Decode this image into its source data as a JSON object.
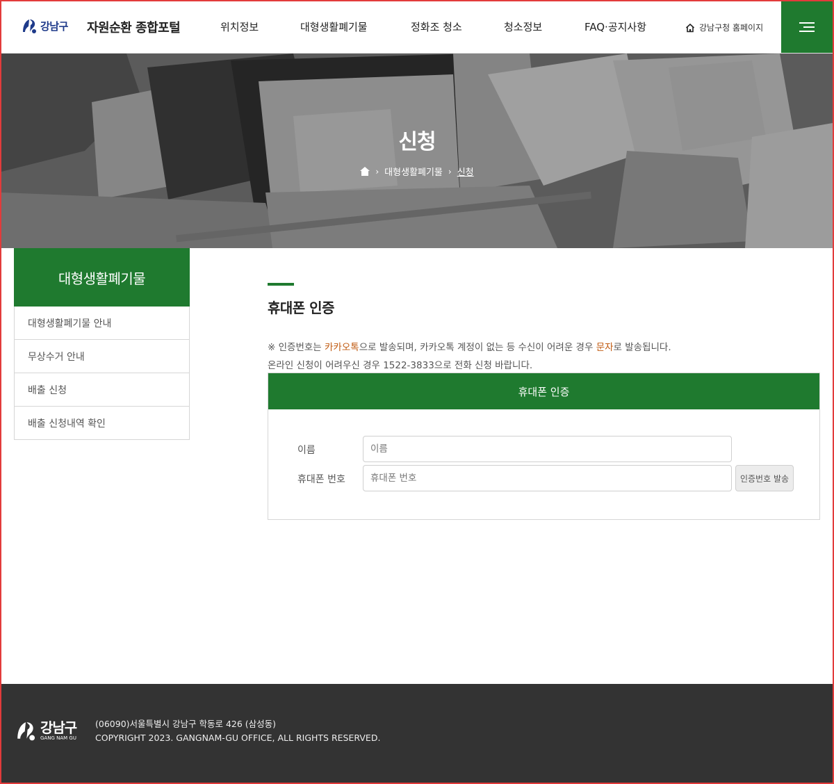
{
  "header": {
    "logo_text": "강남구",
    "site_title": "자원순환 종합포털",
    "nav": [
      "위치정보",
      "대형생활폐기물",
      "정화조 청소",
      "청소정보",
      "FAQ·공지사항"
    ],
    "home_link": "강남구청 홈페이지",
    "menu_icon": "hamburger-icon"
  },
  "hero": {
    "title": "신청",
    "breadcrumb": [
      "대형생활폐기물",
      "신청"
    ],
    "home_icon": "home-icon"
  },
  "sidebar": {
    "title": "대형생활폐기물",
    "items": [
      "대형생활폐기물 안내",
      "무상수거 안내",
      "배출 신청",
      "배출 신청내역 확인"
    ]
  },
  "content": {
    "section_title": "휴대폰 인증",
    "notice_line1": {
      "prefix": "※ 인증번호는 ",
      "hl1": "카카오톡",
      "middle": "으로 발송되며, 카카오톡 계정이 없는 등 수신이 어려운 경우 ",
      "hl2": "문자",
      "suffix": "로 발송됩니다."
    },
    "notice_line2": "온라인 신청이 어려우신 경우 1522-3833으로 전화 신청 바랍니다."
  },
  "auth": {
    "title": "휴대폰 인증",
    "name_label": "이름",
    "name_placeholder": "이름",
    "phone_label": "휴대폰 번호",
    "phone_placeholder": "휴대폰 번호",
    "send_button": "인증번호 발송"
  },
  "footer": {
    "logo_ko": "강남구",
    "logo_en": "GANG NAM GU",
    "address": "(06090)서울특별시 강남구 학동로 426 (삼성동)",
    "copyright": "COPYRIGHT 2023. GANGNAM-GU OFFICE, ALL RIGHTS RESERVED."
  },
  "colors": {
    "brand_green": "#1f7a2f",
    "highlight_orange": "#c05a10",
    "footer_bg": "#333333"
  }
}
